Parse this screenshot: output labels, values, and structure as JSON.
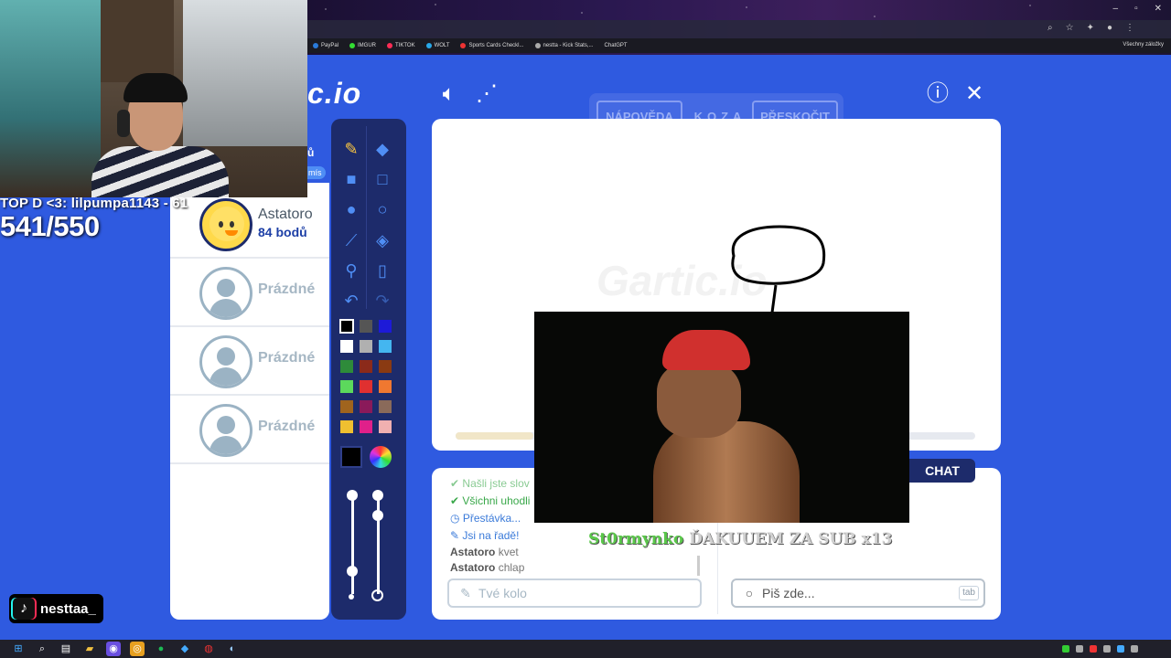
{
  "browser": {
    "bookmarks": [
      "PayPal",
      "IMGUR",
      "TIKTOK",
      "WOLT",
      "Sports Cards Checkl...",
      "nestta - Kick Stats,...",
      "ChatGPT"
    ],
    "bookmarks_right": "Všechny záložky"
  },
  "stream": {
    "top_donor_line": "TOP D <3: lilpumpa1143 - 61",
    "counter": "541/550",
    "tiktok_handle": "nesttaa_"
  },
  "game": {
    "logo_text": "c.io",
    "nav": {
      "help": "NÁPOVĚDA",
      "word": "KOZA",
      "skip": "PŘESKOČIT"
    },
    "panel_caption_1": "ů",
    "panel_caption_2": "mís",
    "players": [
      {
        "name": "Astatoro",
        "score": "84 bodů",
        "active": true
      },
      {
        "name": "Prázdné"
      },
      {
        "name": "Prázdné"
      },
      {
        "name": "Prázdné"
      }
    ],
    "palette": [
      "#000000",
      "#555555",
      "#1d1ad8",
      "#ffffff",
      "#b0b0b0",
      "#44b6f0",
      "#2e8b3a",
      "#8b2a1a",
      "#8a3a12",
      "#5cd95c",
      "#e03030",
      "#f07830",
      "#a0641e",
      "#8a1a5a",
      "#8a6a5a",
      "#f0c030",
      "#e0208a",
      "#f0b0b0"
    ],
    "progress_fraction": 0.15,
    "chat_tab_label": "CHAT",
    "messages": [
      {
        "type": "green",
        "icon": "✔",
        "text": "Našli jste slov"
      },
      {
        "type": "green",
        "icon": "✔",
        "text": "Všichni uhodli"
      },
      {
        "type": "blue",
        "icon": "◷",
        "text": "Přestávka..."
      },
      {
        "type": "blue",
        "icon": "✎",
        "text": "Jsi na řadě!"
      },
      {
        "type": "user",
        "who": "Astatoro",
        "text": "kvet"
      },
      {
        "type": "user",
        "who": "Astatoro",
        "text": "chlap"
      }
    ],
    "answer_placeholder": "Tvé kolo",
    "chat_placeholder": "Piš zde...",
    "tab_key": "tab"
  },
  "alert": {
    "user": "St0rmynko",
    "text": " ĎAKUUEM ZA SUB x13"
  },
  "colors": {
    "page_bg": "#2f5ae0",
    "panel_dark": "#1d2b6b",
    "accent_blue": "#4f8ef5"
  }
}
